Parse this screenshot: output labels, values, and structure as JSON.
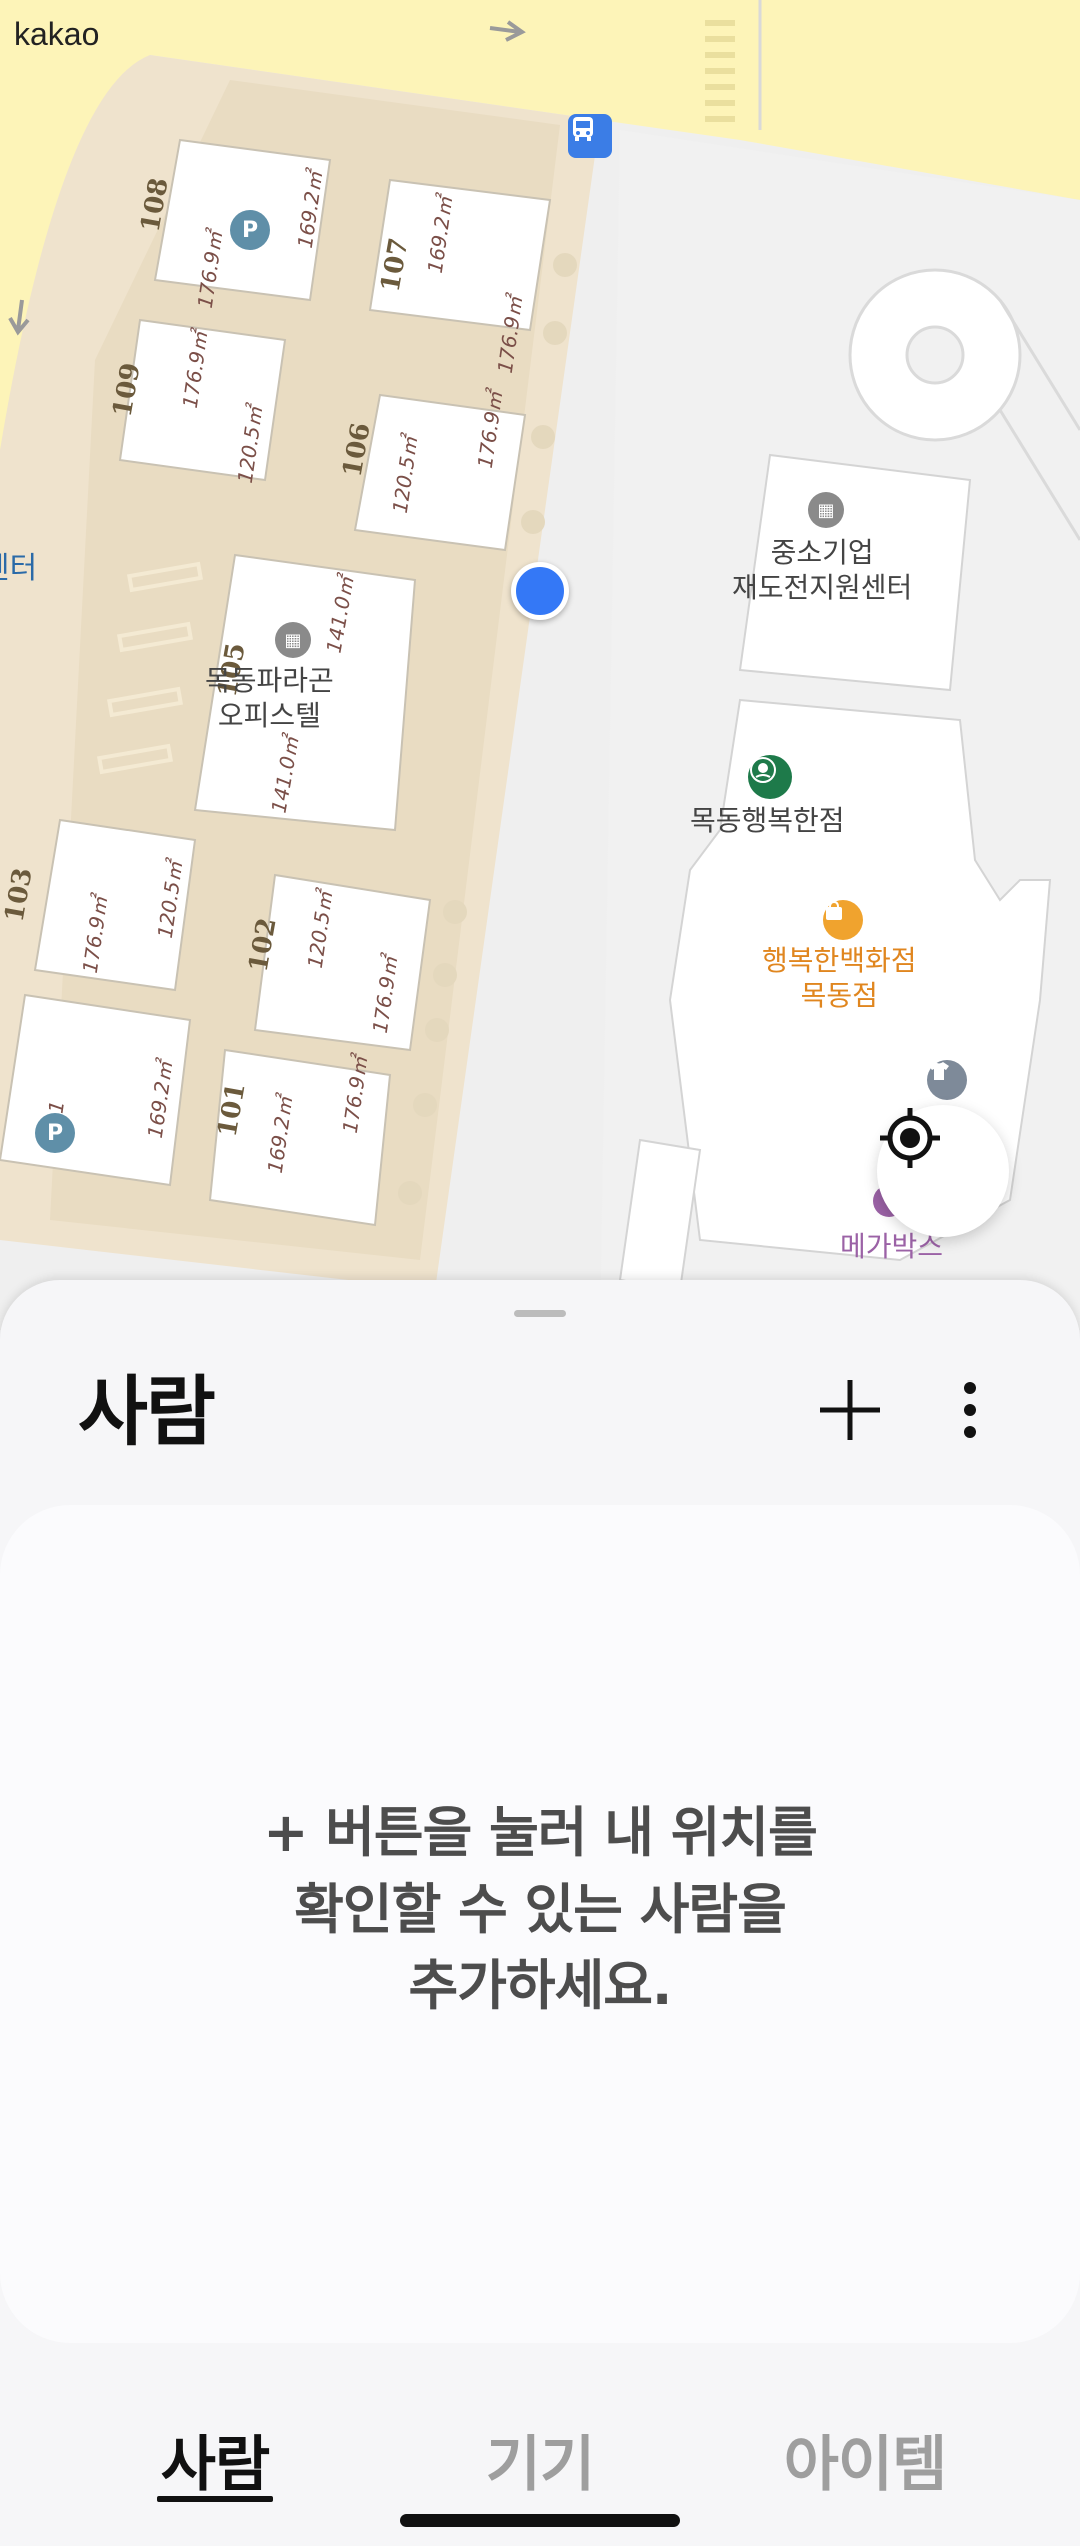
{
  "map": {
    "brand": "kakao",
    "buildings": [
      {
        "number": "108",
        "areas": [
          "176.9㎡",
          "169.2㎡"
        ]
      },
      {
        "number": "107",
        "areas": [
          "169.2㎡",
          "176.9㎡"
        ]
      },
      {
        "number": "109",
        "areas": [
          "176.9㎡",
          "120.5㎡"
        ]
      },
      {
        "number": "106",
        "areas": [
          "120.5㎡",
          "176.9㎡"
        ]
      },
      {
        "number": "105",
        "areas": [
          "141.0㎡",
          "141.0㎡"
        ]
      },
      {
        "number": "103",
        "areas": [
          "176.9㎡",
          "120.5㎡"
        ]
      },
      {
        "number": "102",
        "areas": [
          "120.5㎡",
          "176.9㎡"
        ]
      },
      {
        "number": "101",
        "areas": [
          "169.2㎡",
          "176.9㎡"
        ]
      },
      {
        "number": "",
        "areas": [
          "1",
          "169.2㎡"
        ]
      }
    ],
    "pois": {
      "complex_name": "목동파라곤\n오피스텔",
      "sme_center": "중소기업\n재도전지원센터",
      "starbucks": "목동행복한점",
      "department_store": "행복한백화점\n목동점",
      "megabox": "메가박스",
      "edge_label": "센터"
    },
    "parking_label": "P",
    "icons": [
      "bus-stop-icon",
      "parking-icon",
      "building-icon",
      "starbucks-icon",
      "shopping-bag-icon",
      "shirt-icon",
      "locate-crosshair-icon"
    ],
    "colors": {
      "location_dot": "#3478f6",
      "road": "#fdf4b8",
      "complex": "#efe3cd"
    }
  },
  "sheet": {
    "title": "사람",
    "add_label": "+",
    "more_label": "⋮",
    "empty_message_lines": [
      "+ 버튼을 눌러 내 위치를",
      "확인할 수 있는 사람을",
      "추가하세요."
    ]
  },
  "tabs": [
    {
      "label": "사람",
      "active": true
    },
    {
      "label": "기기",
      "active": false
    },
    {
      "label": "아이템",
      "active": false
    }
  ]
}
